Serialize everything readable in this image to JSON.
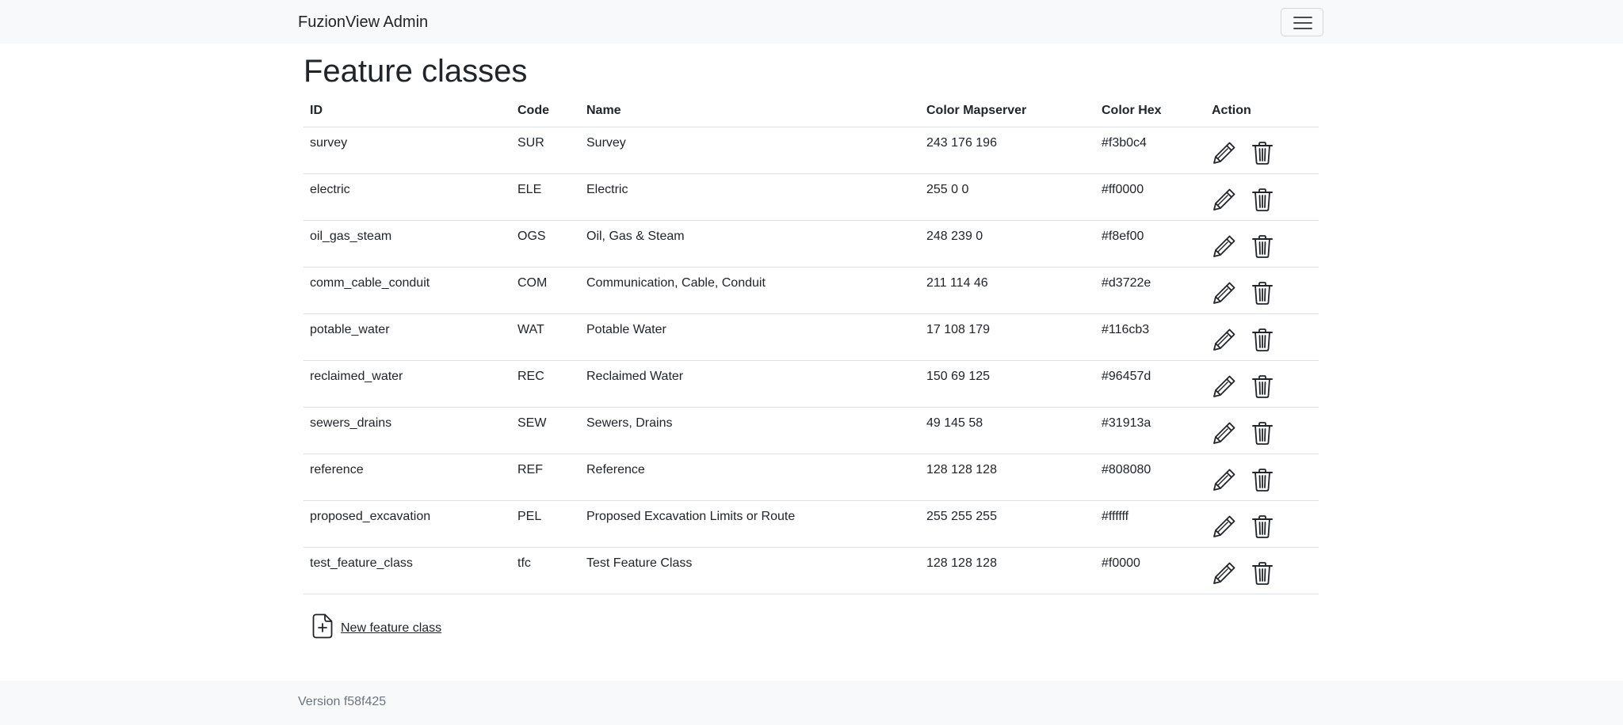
{
  "navbar": {
    "brand": "FuzionView Admin",
    "toggle_icon": "hamburger-menu-icon"
  },
  "page": {
    "title": "Feature classes"
  },
  "table": {
    "headers": {
      "id": "ID",
      "code": "Code",
      "name": "Name",
      "color_mapserver": "Color Mapserver",
      "color_hex": "Color Hex",
      "action": "Action"
    },
    "rows": [
      {
        "id": "survey",
        "code": "SUR",
        "name": "Survey",
        "color_mapserver": "243 176 196",
        "color_hex": "#f3b0c4"
      },
      {
        "id": "electric",
        "code": "ELE",
        "name": "Electric",
        "color_mapserver": "255 0 0",
        "color_hex": "#ff0000"
      },
      {
        "id": "oil_gas_steam",
        "code": "OGS",
        "name": "Oil, Gas & Steam",
        "color_mapserver": "248 239 0",
        "color_hex": "#f8ef00"
      },
      {
        "id": "comm_cable_conduit",
        "code": "COM",
        "name": "Communication, Cable, Conduit",
        "color_mapserver": "211 114 46",
        "color_hex": "#d3722e"
      },
      {
        "id": "potable_water",
        "code": "WAT",
        "name": "Potable Water",
        "color_mapserver": "17 108 179",
        "color_hex": "#116cb3"
      },
      {
        "id": "reclaimed_water",
        "code": "REC",
        "name": "Reclaimed Water",
        "color_mapserver": "150 69 125",
        "color_hex": "#96457d"
      },
      {
        "id": "sewers_drains",
        "code": "SEW",
        "name": "Sewers, Drains",
        "color_mapserver": "49 145 58",
        "color_hex": "#31913a"
      },
      {
        "id": "reference",
        "code": "REF",
        "name": "Reference",
        "color_mapserver": "128 128 128",
        "color_hex": "#808080"
      },
      {
        "id": "proposed_excavation",
        "code": "PEL",
        "name": "Proposed Excavation Limits or Route",
        "color_mapserver": "255 255 255",
        "color_hex": "#ffffff"
      },
      {
        "id": "test_feature_class",
        "code": "tfc",
        "name": "Test Feature Class",
        "color_mapserver": "128 128 128",
        "color_hex": "#f0000"
      }
    ],
    "row_actions": {
      "edit_icon": "pencil-icon",
      "delete_icon": "trash-icon"
    }
  },
  "new_feature": {
    "label": "New feature class",
    "icon": "file-plus-icon"
  },
  "footer": {
    "version": "Version f58f425"
  },
  "colors": {
    "navbar_bg": "#f8f9fa",
    "text": "#212529",
    "muted": "#6c757d",
    "border": "#dee2e6"
  }
}
